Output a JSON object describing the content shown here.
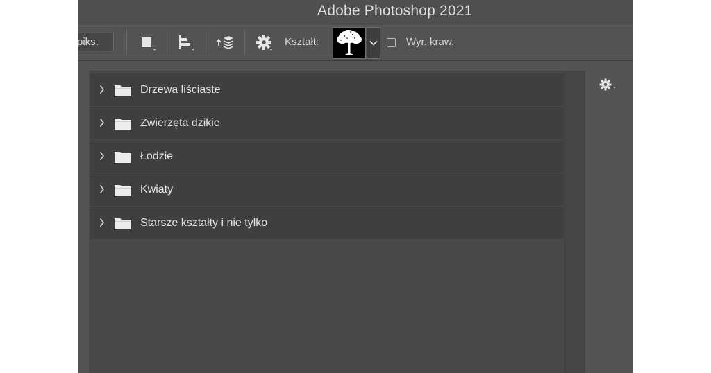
{
  "window": {
    "title": "Adobe Photoshop 2021"
  },
  "options_bar": {
    "feather_value": "piks.",
    "shape_label": "Kształt:",
    "anti_alias_label": "Wyr. kraw.",
    "anti_alias_checked": false,
    "icons": [
      "fill-square-icon",
      "align-icon",
      "arrange-layers-icon",
      "gear-icon",
      "tree-shape-thumbnail",
      "chevron-down-icon"
    ]
  },
  "shape_panel": {
    "folders": [
      {
        "label": "Drzewa liściaste"
      },
      {
        "label": "Zwierzęta dzikie"
      },
      {
        "label": "Łodzie"
      },
      {
        "label": "Kwiaty"
      },
      {
        "label": "Starsze kształty i nie tylko"
      }
    ]
  },
  "colors": {
    "app_bg": "#535353",
    "panel_bg": "#484848",
    "row_bg": "#3f3f3f",
    "text": "#e4e4e4"
  }
}
